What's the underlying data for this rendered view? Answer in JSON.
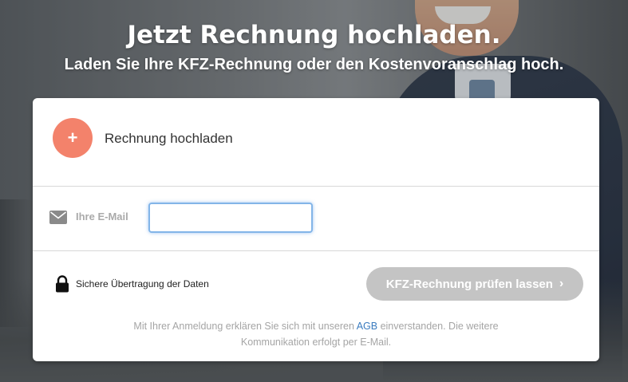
{
  "header": {
    "title": "Jetzt Rechnung hochladen.",
    "subtitle": "Laden Sie Ihre KFZ-Rechnung oder den Kostenvoranschlag hoch."
  },
  "upload": {
    "button_symbol": "+",
    "label": "Rechnung hochladen",
    "accent_color": "#f3826b"
  },
  "email": {
    "icon": "mail-icon",
    "label": "Ihre E-Mail",
    "value": "",
    "placeholder": ""
  },
  "security": {
    "icon": "lock-icon",
    "label": "Sichere Übertragung der Daten"
  },
  "submit": {
    "label": "KFZ-Rechnung prüfen lassen",
    "chevron": "›",
    "state": "disabled"
  },
  "legal": {
    "before_link": "Mit Ihrer Anmeldung erklären Sie sich mit unseren ",
    "link_text": "AGB",
    "after_link": " einverstanden. Die weitere Kommunikation erfolgt per E-Mail."
  }
}
